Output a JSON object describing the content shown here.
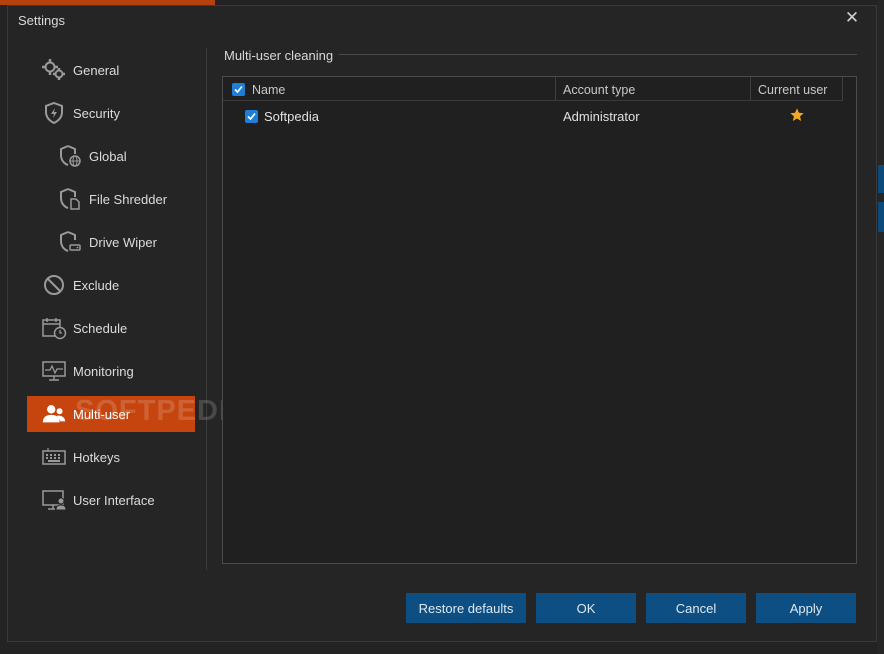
{
  "dialog": {
    "title": "Settings",
    "close_glyph": "✕"
  },
  "sidebar": {
    "items": [
      {
        "label": "General",
        "icon": "gears-icon"
      },
      {
        "label": "Security",
        "icon": "shield-icon"
      },
      {
        "label": "Global",
        "icon": "shield-globe-icon"
      },
      {
        "label": "File Shredder",
        "icon": "shield-file-icon"
      },
      {
        "label": "Drive Wiper",
        "icon": "shield-drive-icon"
      },
      {
        "label": "Exclude",
        "icon": "prohibited-icon"
      },
      {
        "label": "Schedule",
        "icon": "calendar-clock-icon"
      },
      {
        "label": "Monitoring",
        "icon": "monitor-pulse-icon"
      },
      {
        "label": "Multi-user",
        "icon": "users-icon",
        "active": true
      },
      {
        "label": "Hotkeys",
        "icon": "keyboard-icon"
      },
      {
        "label": "User Interface",
        "icon": "monitor-user-icon"
      }
    ]
  },
  "watermark": "SOFTPEDIA",
  "content": {
    "section_title": "Multi-user cleaning",
    "table": {
      "columns": [
        "Name",
        "Account type",
        "Current user"
      ],
      "header_checked": true,
      "rows": [
        {
          "checked": true,
          "name": "Softpedia",
          "account_type": "Administrator",
          "current_user": "star-icon"
        }
      ]
    }
  },
  "buttons": {
    "restore": "Restore defaults",
    "ok": "OK",
    "cancel": "Cancel",
    "apply": "Apply"
  },
  "colors": {
    "accent_active": "#c6450e",
    "button_blue": "#0d4f82",
    "checkbox_blue": "#1f7fd6",
    "star": "#f5a623"
  }
}
